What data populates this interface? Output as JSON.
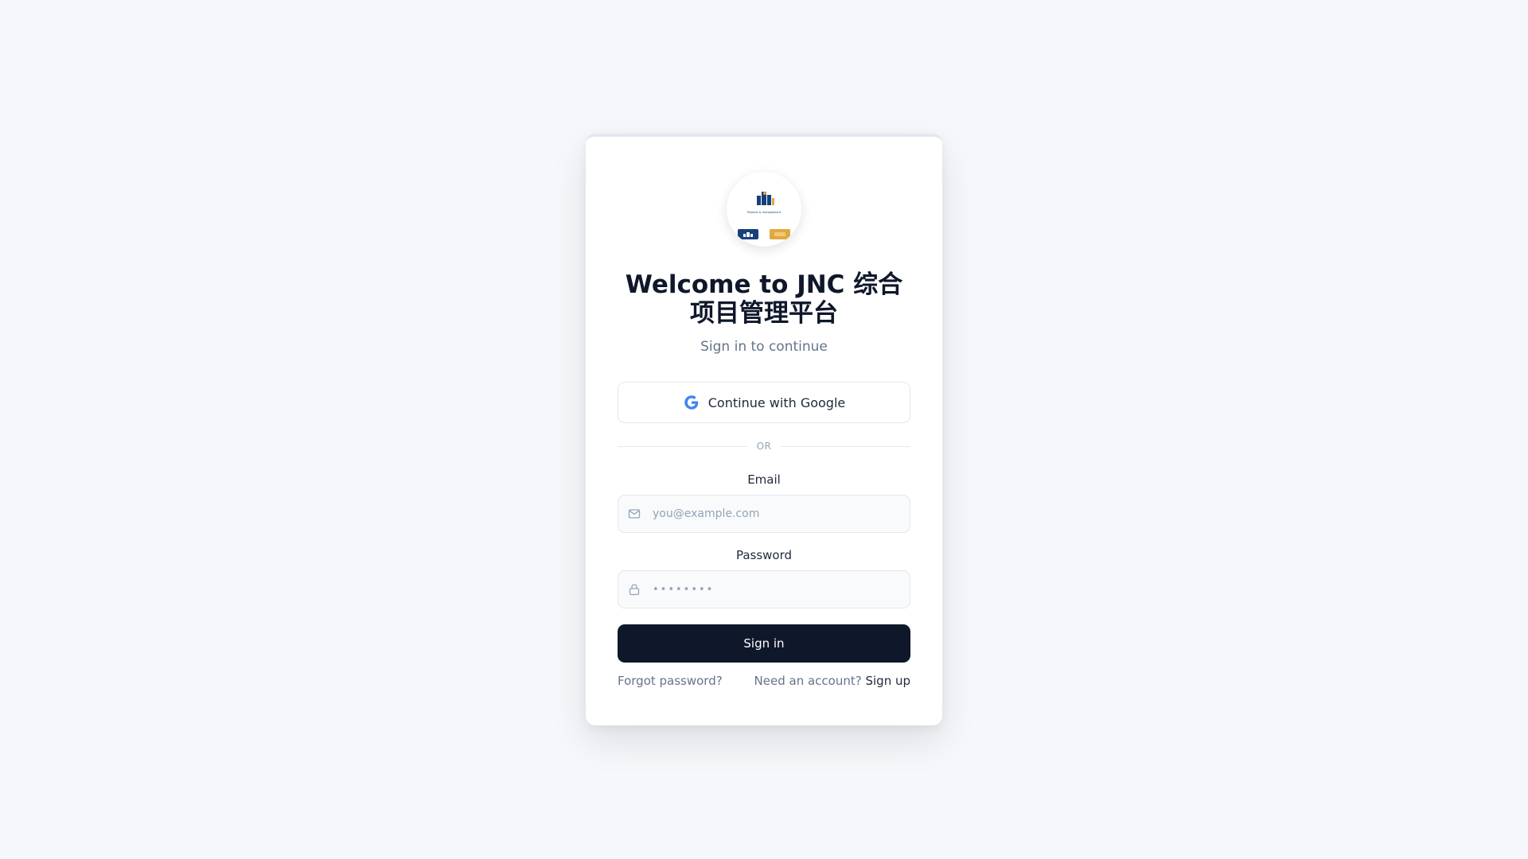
{
  "colors": {
    "background": "#f5f7fa",
    "card": "#ffffff",
    "primary_button": "#0f172a",
    "muted_text": "#64748b",
    "google_blue": "#4285F4",
    "logo_navy": "#17407a",
    "logo_gold": "#e0a940"
  },
  "logo": {
    "icon": "company-logo",
    "tagline": "Projects & management"
  },
  "header": {
    "title": "Welcome to JNC 综合项目管理平台",
    "subtitle": "Sign in to continue"
  },
  "google": {
    "icon": "google-g-icon",
    "label": "Continue with Google"
  },
  "divider": {
    "text": "OR"
  },
  "email": {
    "label": "Email",
    "placeholder": "you@example.com",
    "value": "",
    "icon": "mail-icon"
  },
  "password": {
    "label": "Password",
    "placeholder": "••••••••",
    "value": "",
    "icon": "lock-icon"
  },
  "actions": {
    "signin_label": "Sign in",
    "forgot_label": "Forgot password?",
    "need_account_label": "Need an account?",
    "signup_label": "Sign up"
  }
}
